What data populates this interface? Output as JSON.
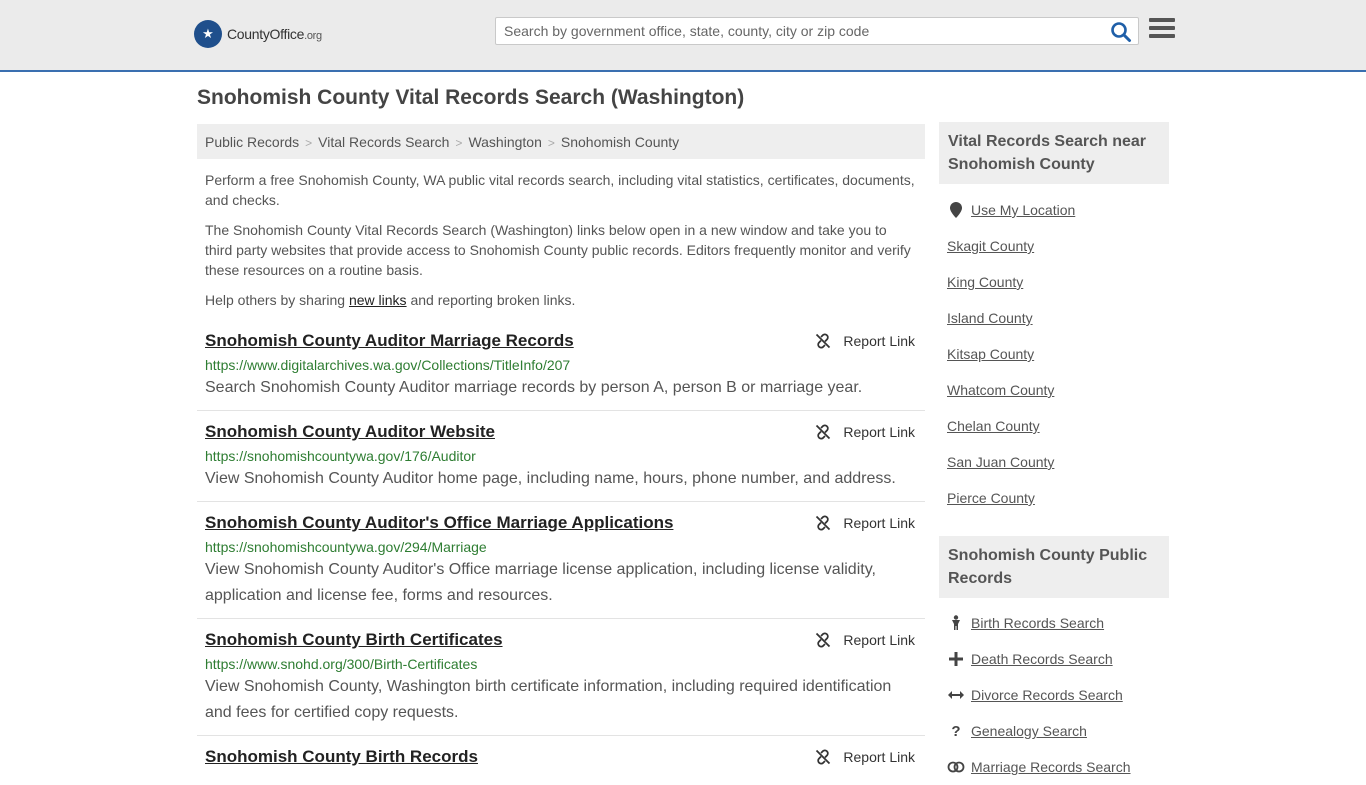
{
  "header": {
    "logo_text": "CountyOffice",
    "logo_suffix": ".org",
    "search_placeholder": "Search by government office, state, county, city or zip code"
  },
  "page_title": "Snohomish County Vital Records Search (Washington)",
  "breadcrumb": [
    "Public Records",
    "Vital Records Search",
    "Washington",
    "Snohomish County"
  ],
  "intro": {
    "p1": "Perform a free Snohomish County, WA public vital records search, including vital statistics, certificates, documents, and checks.",
    "p2": "The Snohomish County Vital Records Search (Washington) links below open in a new window and take you to third party websites that provide access to Snohomish County public records. Editors frequently monitor and verify these resources on a routine basis.",
    "p3_before": "Help others by sharing ",
    "p3_link": "new links",
    "p3_after": " and reporting broken links."
  },
  "report_label": "Report Link",
  "results": [
    {
      "title": "Snohomish County Auditor Marriage Records",
      "url": "https://www.digitalarchives.wa.gov/Collections/TitleInfo/207",
      "desc": "Search Snohomish County Auditor marriage records by person A, person B or marriage year."
    },
    {
      "title": "Snohomish County Auditor Website",
      "url": "https://snohomishcountywa.gov/176/Auditor",
      "desc": "View Snohomish County Auditor home page, including name, hours, phone number, and address."
    },
    {
      "title": "Snohomish County Auditor's Office Marriage Applications",
      "url": "https://snohomishcountywa.gov/294/Marriage",
      "desc": "View Snohomish County Auditor's Office marriage license application, including license validity, application and license fee, forms and resources."
    },
    {
      "title": "Snohomish County Birth Certificates",
      "url": "https://www.snohd.org/300/Birth-Certificates",
      "desc": "View Snohomish County, Washington birth certificate information, including required identification and fees for certified copy requests."
    },
    {
      "title": "Snohomish County Birth Records",
      "url": "",
      "desc": ""
    }
  ],
  "sidebar": {
    "nearby_heading": "Vital Records Search near Snohomish County",
    "use_location": "Use My Location",
    "nearby": [
      "Skagit County",
      "King County",
      "Island County",
      "Kitsap County",
      "Whatcom County",
      "Chelan County",
      "San Juan County",
      "Pierce County"
    ],
    "public_heading": "Snohomish County Public Records",
    "public_links": [
      {
        "label": "Birth Records Search",
        "icon": "birth-icon"
      },
      {
        "label": "Death Records Search",
        "icon": "cross-icon"
      },
      {
        "label": "Divorce Records Search",
        "icon": "arrows-icon"
      },
      {
        "label": "Genealogy Search",
        "icon": "question-icon"
      },
      {
        "label": "Marriage Records Search",
        "icon": "rings-icon"
      }
    ]
  }
}
